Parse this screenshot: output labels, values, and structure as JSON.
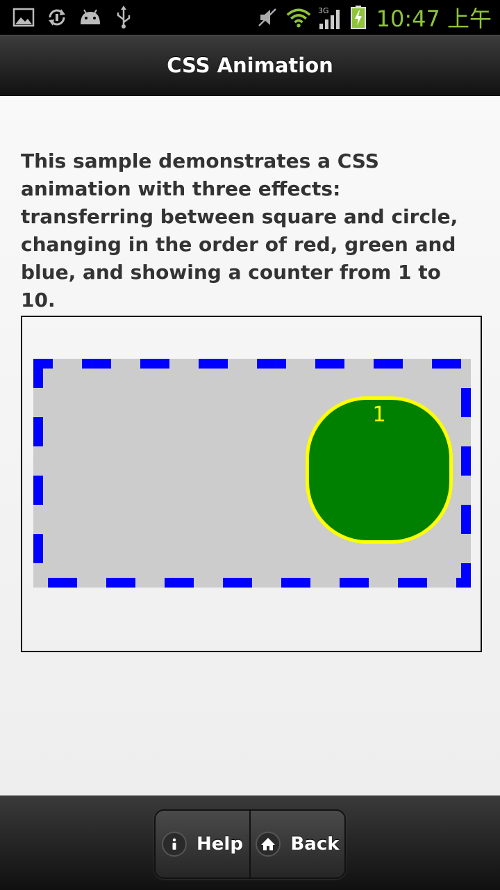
{
  "status_bar": {
    "time": "10:47 上午",
    "network": "3G",
    "left_icons": [
      "image-icon",
      "sync-icon",
      "android-icon",
      "usb-icon"
    ],
    "right_icons": [
      "mute-icon",
      "wifi-icon",
      "signal-icon",
      "battery-charging-icon"
    ]
  },
  "header": {
    "title": "CSS Animation"
  },
  "content": {
    "description": "This sample demonstrates a CSS animation with three effects: transferring between square and circle, changing in the order of red, green and blue, and showing a counter from 1 to 10.",
    "animation": {
      "counter": "1",
      "shape_color": "#008000",
      "shape_border_color": "#ffff00",
      "area_color": "#cccccc",
      "area_border_color": "#0000ff"
    }
  },
  "footer": {
    "help_label": "Help",
    "back_label": "Back"
  }
}
